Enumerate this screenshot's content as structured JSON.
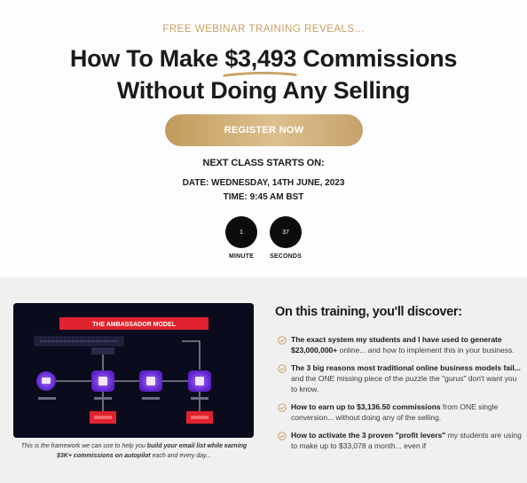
{
  "hero": {
    "eyebrow": "FREE WEBINAR TRAINING REVEALS...",
    "headline_pre": "How To Make ",
    "headline_amount": "$3,493",
    "headline_post": " Commissions",
    "headline_line2": "Without Doing Any Selling",
    "register_label": "REGISTER NOW",
    "next_class_label": "NEXT CLASS STARTS ON:",
    "date_text": "DATE: WEDNESDAY, 14TH JUNE, 2023",
    "time_text": "TIME: 9:45 AM BST"
  },
  "timer": {
    "units": [
      {
        "value": "1",
        "label": "MINUTE"
      },
      {
        "value": "37",
        "label": "SECONDS"
      }
    ]
  },
  "framework": {
    "title": "THE AMBASSADOR MODEL",
    "caption_pre": "This is the framework we can use to help you ",
    "caption_bold1": "build your email list",
    "caption_mid": " while earning $3K+ commissions on autopilot",
    "caption_post": " each and every day..."
  },
  "discover": {
    "title": "On this training, you'll discover:",
    "items": [
      {
        "lead": "The exact system my students and I have used to generate $23,000,000+",
        "rest": " online... and how to implement this in your business."
      },
      {
        "lead": "The 3 big reasons most traditional online business models fail...",
        "rest": " and the ONE missing piece of the puzzle the \"gurus\" don't want you to know."
      },
      {
        "lead": "How to earn up to $3,136.50 commissions",
        "rest": " from ONE single conversion... without doing any of the selling."
      },
      {
        "lead": "How to activate the 3 proven \"profit levers\"",
        "rest": " my students are using to make up to $33,078 a month... even if"
      }
    ]
  },
  "colors": {
    "gold": "#c9a063",
    "button_gradient_start": "#c29a5c",
    "button_gradient_end": "#dcc08f",
    "timer_circle": "#0c0c0c",
    "band_background": "#f0f0f0",
    "framework_bg": "#0b0b1e",
    "framework_purple": "#7b3cf0",
    "framework_red": "#e0232e"
  }
}
